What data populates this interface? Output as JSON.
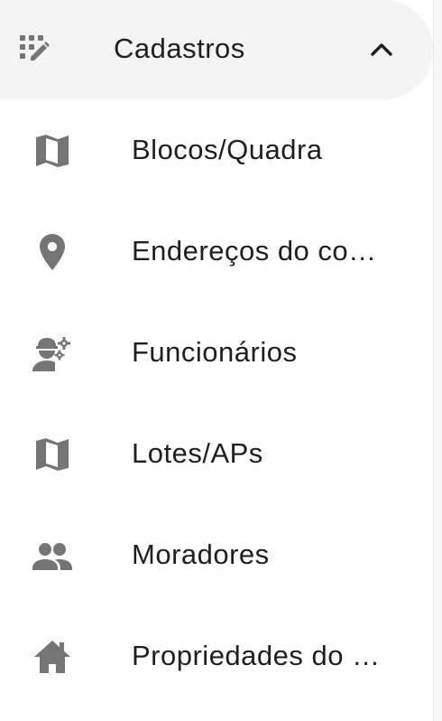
{
  "menu": {
    "group": {
      "label": "Cadastros",
      "icon": "edit-grid-icon",
      "expanded": true,
      "chevron_icon": "chevron-up-icon"
    },
    "items": [
      {
        "label": "Blocos/Quadra",
        "icon": "map-icon"
      },
      {
        "label": "Endereços do co…",
        "icon": "location-pin-icon"
      },
      {
        "label": "Funcionários",
        "icon": "engineering-icon"
      },
      {
        "label": "Lotes/APs",
        "icon": "map-icon"
      },
      {
        "label": "Moradores",
        "icon": "people-icon"
      },
      {
        "label": "Propriedades do …",
        "icon": "house-icon"
      }
    ]
  },
  "colors": {
    "icon": "#757575",
    "text": "#1f1f1f",
    "header_bg": "#f4f4f4"
  }
}
